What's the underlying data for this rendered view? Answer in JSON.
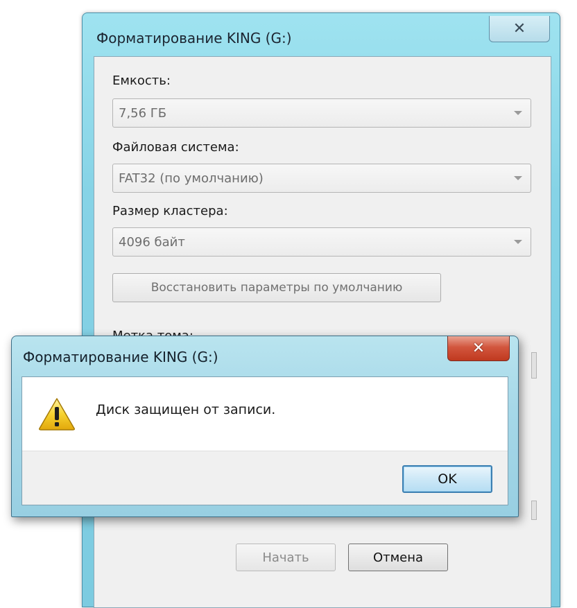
{
  "main_window": {
    "title": "Форматирование KING (G:)",
    "close_glyph": "✕",
    "capacity_label": "Емкость:",
    "capacity_value": "7,56 ГБ",
    "filesystem_label": "Файловая система:",
    "filesystem_value": "FAT32 (по умолчанию)",
    "cluster_label": "Размер кластера:",
    "cluster_value": "4096 байт",
    "restore_defaults_button": "Восстановить параметры по умолчанию",
    "volume_label_partial": "Метка тома:",
    "start_button": "Начать",
    "cancel_button": "Отмена"
  },
  "dialog": {
    "title": "Форматирование KING (G:)",
    "close_glyph": "✕",
    "icon": "warning-icon",
    "message": "Диск защищен от записи.",
    "ok_button": "OK"
  }
}
